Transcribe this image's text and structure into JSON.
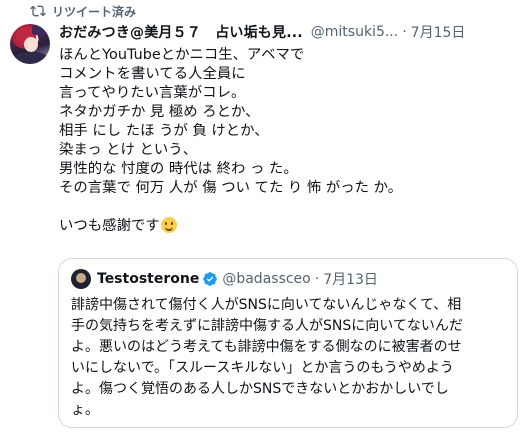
{
  "retweet": {
    "label": "リツイート済み"
  },
  "tweet": {
    "display_name": "おだみつき@美月５７　占い垢も見...",
    "handle": "@mitsuki5...",
    "separator": "·",
    "date": "7月15日",
    "lines": [
      "ほんとYouTubeとかニコ生、アベマで",
      "コメントを書いてる人全員に",
      "言ってやりたい言葉がコレ。",
      "ネタかガチか 見 極め ろとか、",
      "相手 にし たほ うが 負 けとか、",
      "染まっ とけ という、",
      "男性的な 忖度の 時代は 終わ っ た。",
      "その言葉で 何万 人が 傷 つい てた り 怖 がった か。"
    ],
    "closing": "いつも感謝です",
    "emoji": "smiling-face-emoji"
  },
  "quote": {
    "display_name": "Testosterone",
    "handle": "@badassceo",
    "separator": "·",
    "date": "7月13日",
    "lines": [
      "誹謗中傷されて傷付く人がSNSに向いてないんじゃなくて、相",
      "手の気持ちを考えずに誹謗中傷する人がSNSに向いてないんだ",
      "よ。悪いのはどう考えても誹謗中傷をする側なのに被害者のせ",
      "いにしないで。「スルースキルない」とか言うのもうやめよう",
      "よ。傷つく覚悟のある人しかSNSできないとかおかしいでし",
      "ょ。"
    ]
  },
  "icons": {
    "retweet": "retweet-icon",
    "more": "more-icon",
    "verified": "verified-badge-icon"
  },
  "colors": {
    "accent": "#1d9bf0",
    "muted": "#536471",
    "text": "#0f1419",
    "border": "#cfd9de"
  }
}
